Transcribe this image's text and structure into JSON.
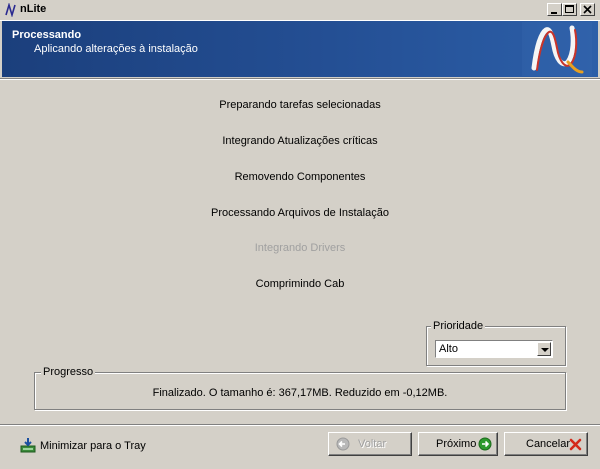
{
  "window": {
    "title": "nLite"
  },
  "header": {
    "title": "Processando",
    "subtitle": "Aplicando alterações à instalação"
  },
  "tasks": [
    {
      "label": "Preparando tarefas selecionadas",
      "enabled": true
    },
    {
      "label": "Integrando Atualizações críticas",
      "enabled": true
    },
    {
      "label": "Removendo Componentes",
      "enabled": true
    },
    {
      "label": "Processando Arquivos de Instalação",
      "enabled": true
    },
    {
      "label": "Integrando Drivers",
      "enabled": false
    },
    {
      "label": "Comprimindo Cab",
      "enabled": true
    }
  ],
  "priority": {
    "legend": "Prioridade",
    "value": "Alto"
  },
  "progress": {
    "legend": "Progresso",
    "status": "Finalizado.  O  tamanho  é:  367,17MB.  Reduzido  em  -0,12MB."
  },
  "footer": {
    "tray_label": "Minimizar para o Tray",
    "back_label": "Voltar",
    "next_label": "Próximo",
    "cancel_label": "Cancelar"
  },
  "colors": {
    "header_bg": "#1b3f7c",
    "face": "#d4d0c8",
    "next_icon": "#2e9a2e",
    "cancel_icon": "#d42a1a"
  }
}
